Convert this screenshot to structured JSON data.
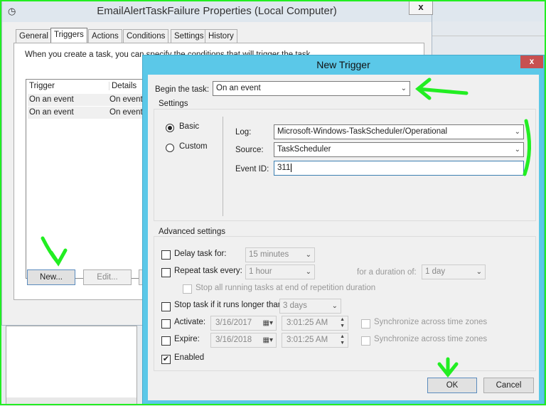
{
  "parent": {
    "title": "EmailAlertTaskFailure Properties (Local Computer)",
    "close": "x",
    "tabs": [
      "General",
      "Triggers",
      "Actions",
      "Conditions",
      "Settings",
      "History"
    ],
    "active_tab": "Triggers",
    "intro": "When you create a task, you can specify the conditions that will trigger the task.",
    "columns": [
      "Trigger",
      "Details"
    ],
    "rows": [
      [
        "On an event",
        "On event"
      ],
      [
        "On an event",
        "On event"
      ]
    ],
    "new_button": "New...",
    "edit_button": "Edit..."
  },
  "dialog": {
    "title": "New Trigger",
    "close": "x",
    "begin_label": "Begin the task:",
    "begin_value": "On an event",
    "settings_label": "Settings",
    "basic": "Basic",
    "custom": "Custom",
    "selected": "Basic",
    "log_label": "Log:",
    "log_value": "Microsoft-Windows-TaskScheduler/Operational",
    "source_label": "Source:",
    "source_value": "TaskScheduler",
    "event_label": "Event ID:",
    "event_value": "311",
    "advanced_label": "Advanced settings",
    "delay_label": "Delay task for:",
    "delay_value": "15 minutes",
    "repeat_label": "Repeat task every:",
    "repeat_value": "1 hour",
    "duration_label": "for a duration of:",
    "duration_value": "1 day",
    "stop_all_label": "Stop all running tasks at end of repetition duration",
    "stop_label": "Stop task if it runs longer than:",
    "stop_value": "3 days",
    "activate_label": "Activate:",
    "activate_date": "3/16/2017",
    "activate_time": "3:01:25 AM",
    "expire_label": "Expire:",
    "expire_date": "3/16/2018",
    "expire_time": "3:01:25 AM",
    "sync_label": "Synchronize across time zones",
    "enabled_label": "Enabled",
    "enabled": true,
    "ok": "OK",
    "cancel": "Cancel"
  },
  "colors": {
    "dialog_border": "#5bc8e8",
    "annotation": "#22ee22",
    "close_red": "#c75050"
  }
}
